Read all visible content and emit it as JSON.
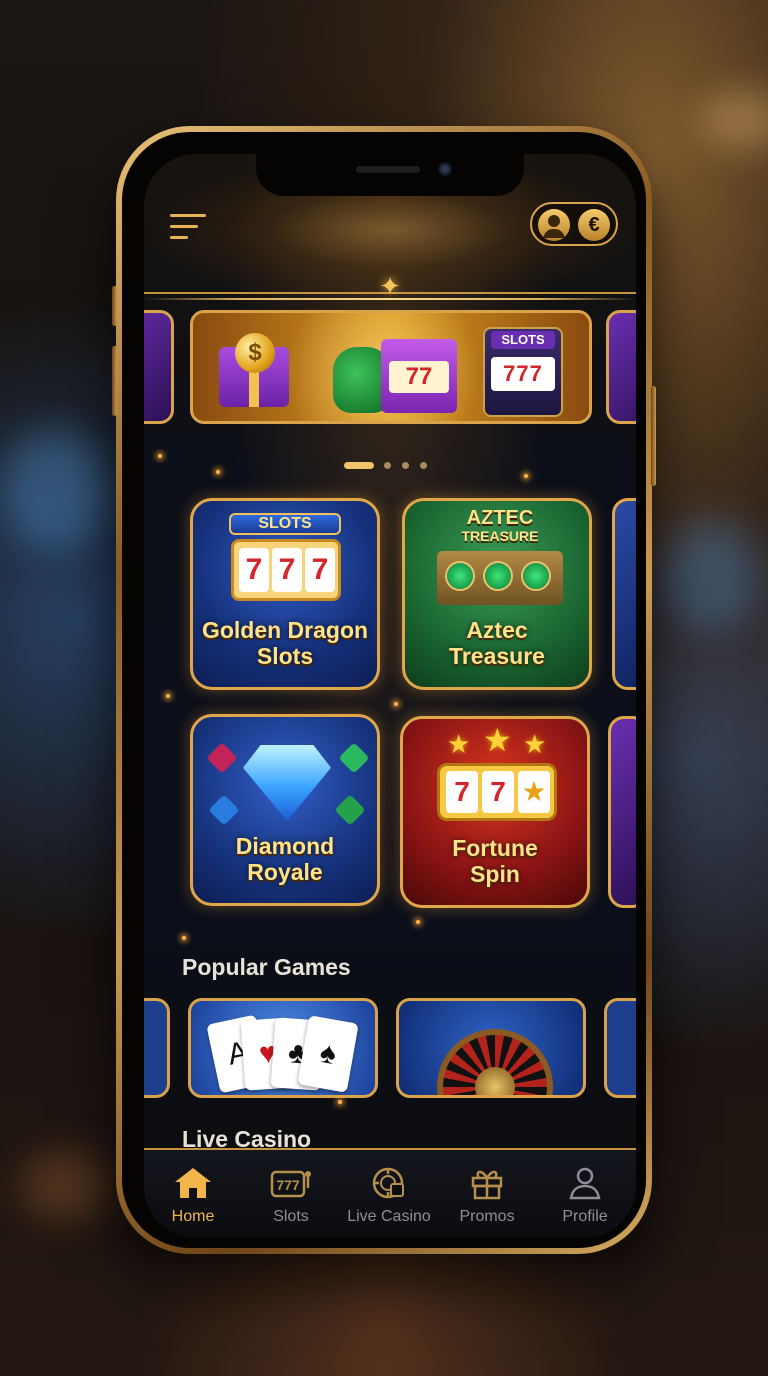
{
  "header": {
    "menu_icon": "hamburger-menu-icon",
    "account_icon": "user-avatar-icon",
    "currency_symbol": "€"
  },
  "banner": {
    "slides_total": 4,
    "active_slide": 1,
    "slot_tag": "SLOTS",
    "slot_reels": "777",
    "coin_symbol": "$",
    "bag_reels": "77"
  },
  "games": [
    {
      "title_line1": "Golden Dragon",
      "title_line2": "Slots",
      "logo": "SLOTS",
      "reels": [
        "7",
        "7",
        "7"
      ]
    },
    {
      "title_line1": "Aztec",
      "title_line2": "Treasure",
      "logo": "AZTEC",
      "logo_sub": "TREASURE"
    },
    {
      "title_line1": "Diamond",
      "title_line2": "Royale"
    },
    {
      "title_line1": "Fortune",
      "title_line2": "Spin",
      "reels": [
        "7",
        "7",
        "★"
      ]
    }
  ],
  "sections": {
    "popular": "Popular Games",
    "live": "Live Casino"
  },
  "popular_cards": {
    "card_suits": [
      "A",
      "♥",
      "♣",
      "♠"
    ]
  },
  "tabbar": [
    {
      "label": "Home",
      "icon": "home-icon",
      "active": true
    },
    {
      "label": "Slots",
      "icon": "slot-machine-icon",
      "active": false
    },
    {
      "label": "Live Casino",
      "icon": "casino-chip-icon",
      "active": false
    },
    {
      "label": "Promos",
      "icon": "gift-icon",
      "active": false
    },
    {
      "label": "Profile",
      "icon": "user-icon",
      "active": false
    }
  ],
  "colors": {
    "accent_gold": "#f2b54a",
    "inactive": "#8e8e95"
  }
}
